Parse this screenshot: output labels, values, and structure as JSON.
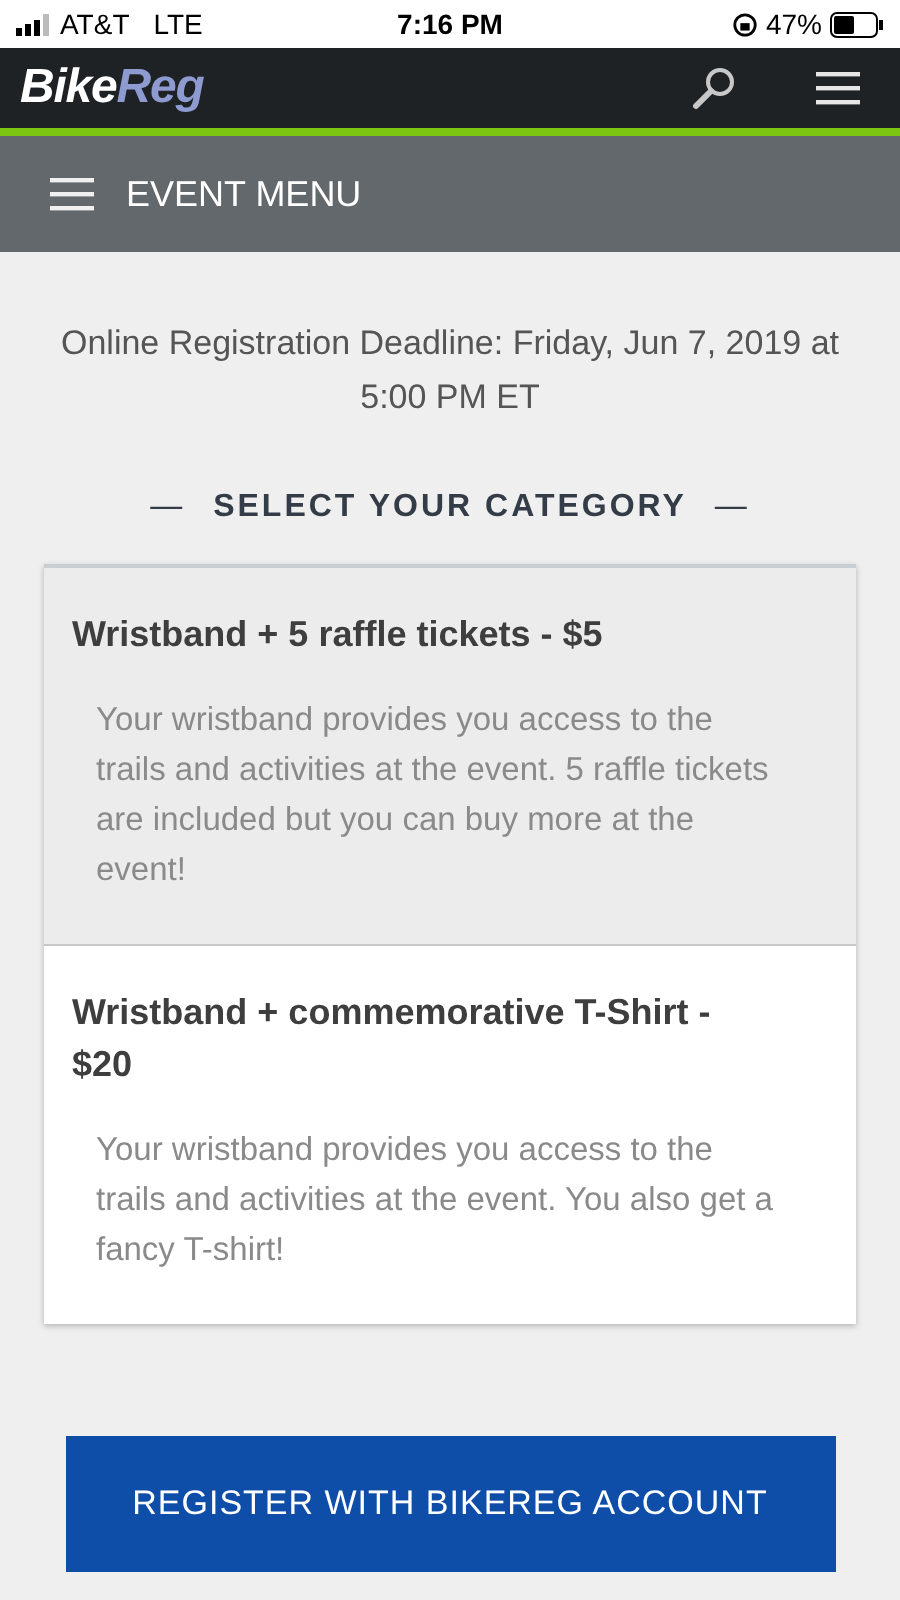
{
  "status_bar": {
    "carrier": "AT&T",
    "network": "LTE",
    "time": "7:16 PM",
    "battery": "47%"
  },
  "header": {
    "logo_left": "Bike",
    "logo_right": "Reg"
  },
  "event_menu": {
    "label": "EVENT MENU"
  },
  "deadline": "Online Registration Deadline: Friday, Jun 7, 2019 at 5:00 PM ET",
  "section_title": {
    "dash_left": "—",
    "label": "SELECT YOUR CATEGORY",
    "dash_right": "—"
  },
  "categories": [
    {
      "title": "Wristband + 5 raffle tickets - $5",
      "description": "Your wristband provides you access to the trails and activities at the event. 5 raffle tickets are included but you can buy more at the event!",
      "selected": true
    },
    {
      "title": "Wristband + commemorative T-Shirt - $20",
      "description": "Your wristband provides you access to the trails and activities at the event. You also get a fancy T-shirt!",
      "selected": false
    }
  ],
  "register_button": "REGISTER WITH BIKEREG ACCOUNT"
}
